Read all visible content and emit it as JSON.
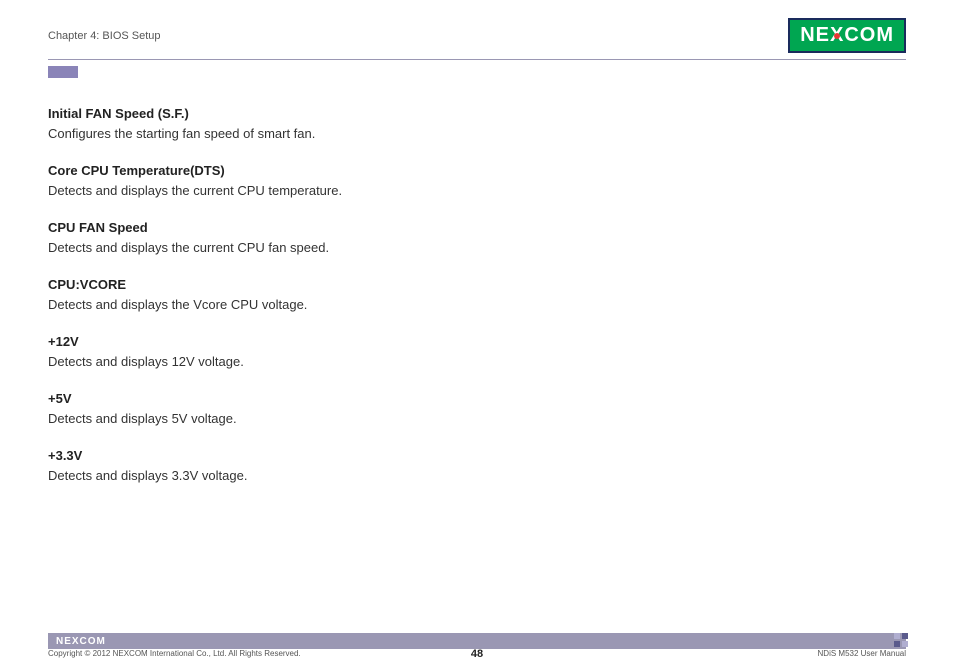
{
  "header": {
    "chapter_title": "Chapter 4: BIOS Setup",
    "logo_text_ne": "NE",
    "logo_text_x": "X",
    "logo_text_com": "COM"
  },
  "content": {
    "items": [
      {
        "title": "Initial FAN Speed (S.F.)",
        "desc": "Configures the starting fan speed of smart fan."
      },
      {
        "title": "Core CPU Temperature(DTS)",
        "desc": "Detects and displays the current CPU temperature."
      },
      {
        "title": "CPU FAN Speed",
        "desc": "Detects and displays the current CPU fan speed."
      },
      {
        "title": "CPU:VCORE",
        "desc": "Detects and displays the Vcore CPU voltage."
      },
      {
        "title": "+12V",
        "desc": "Detects and displays 12V voltage."
      },
      {
        "title": "+5V",
        "desc": "Detects and displays 5V voltage."
      },
      {
        "title": "+3.3V",
        "desc": "Detects and displays 3.3V voltage."
      }
    ]
  },
  "footer": {
    "logo_small": "NEXCOM",
    "copyright": "Copyright © 2012 NEXCOM International Co., Ltd. All Rights Reserved.",
    "page_number": "48",
    "manual_name": "NDiS M532 User Manual"
  }
}
